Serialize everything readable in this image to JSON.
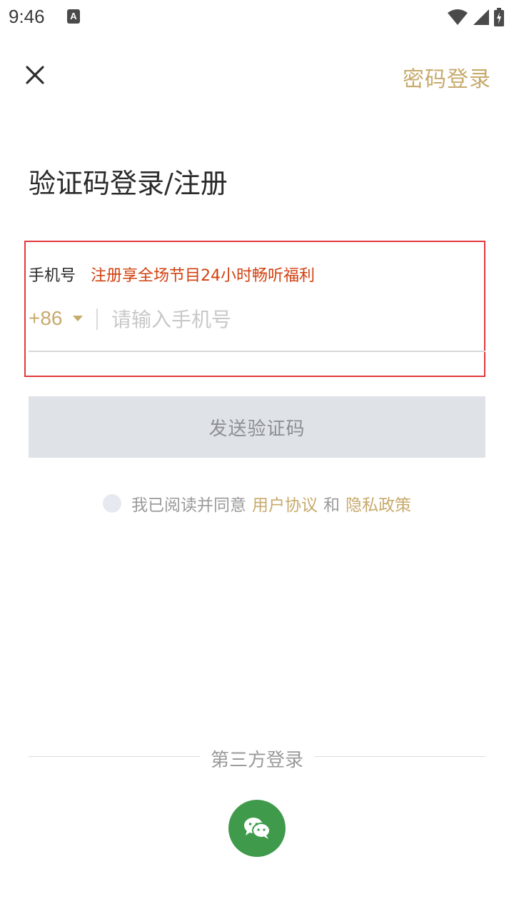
{
  "status_bar": {
    "time": "9:46",
    "notif_letter": "A"
  },
  "header": {
    "password_login": "密码登录"
  },
  "title": "验证码登录/注册",
  "phone_field": {
    "label": "手机号",
    "promo": "注册享全场节目24小时畅听福利",
    "country_code": "+86",
    "placeholder": "请输入手机号",
    "value": ""
  },
  "send_button": "发送验证码",
  "agreement": {
    "prefix": "我已阅读并同意",
    "user_agreement": "用户协议",
    "and": "和",
    "privacy_policy": "隐私政策",
    "checked": false
  },
  "third_party": {
    "label": "第三方登录"
  },
  "colors": {
    "accent_gold": "#c7aa6c",
    "promo_orange": "#d2400f",
    "highlight_red": "#e0393e",
    "wechat_green": "#3f9b4b",
    "button_disabled_bg": "#dfe2e6"
  },
  "icons": {
    "close": "close-icon",
    "wechat": "wechat-icon",
    "wifi": "wifi-icon",
    "signal": "signal-icon",
    "battery": "battery-icon"
  }
}
